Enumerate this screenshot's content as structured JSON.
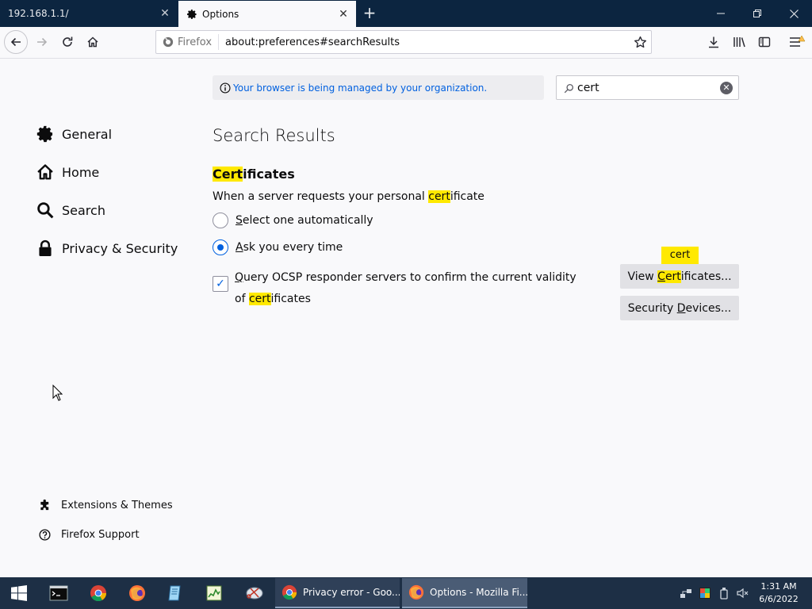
{
  "window": {
    "colors": {
      "titlebar": "#0c2540",
      "accent": "#0060df",
      "highlight": "#ffe900"
    },
    "tabs": [
      {
        "label": "192.168.1.1/",
        "active": false
      },
      {
        "label": "Options",
        "active": true
      }
    ]
  },
  "navbar": {
    "identity_label": "Firefox",
    "url": "about:preferences#searchResults"
  },
  "preferences": {
    "policy_banner": "Your browser is being managed by your organization.",
    "search": {
      "value": "cert"
    },
    "categories": [
      {
        "label": "General",
        "icon": "gear-icon"
      },
      {
        "label": "Home",
        "icon": "home-icon"
      },
      {
        "label": "Search",
        "icon": "search-icon"
      },
      {
        "label": "Privacy & Security",
        "icon": "lock-icon"
      }
    ],
    "footer_links": [
      {
        "label": "Extensions & Themes",
        "icon": "puzzle-icon"
      },
      {
        "label": "Firefox Support",
        "icon": "help-icon"
      }
    ],
    "results_title": "Search Results",
    "section": {
      "heading_hl": "Cert",
      "heading_rest": "ificates",
      "desc_pre": "When a server requests your personal ",
      "desc_hl": "cert",
      "desc_post": "ificate",
      "radio_auto": {
        "first": "S",
        "rest": "elect one automatically",
        "checked": false
      },
      "radio_ask": {
        "first": "A",
        "rest": "sk you every time",
        "checked": true
      },
      "ocsp": {
        "first": "Q",
        "rest": "uery OCSP responder servers to confirm the current validity of ",
        "hl": "cert",
        "post": "ificates",
        "checked": true
      },
      "view_certs": {
        "pre": "View ",
        "hl_first": "C",
        "hl_rest": "ert",
        "post": "ificates..."
      },
      "security_devices": {
        "pre": "Security ",
        "u": "D",
        "post": "evices..."
      },
      "tooltip": "cert"
    }
  },
  "taskbar": {
    "apps": [
      {
        "label": "Privacy error - Goo...",
        "icon": "chrome-icon"
      },
      {
        "label": "Options - Mozilla Fi...",
        "icon": "firefox-icon"
      }
    ],
    "clock": {
      "time": "1:31 AM",
      "date": "6/6/2022"
    }
  }
}
